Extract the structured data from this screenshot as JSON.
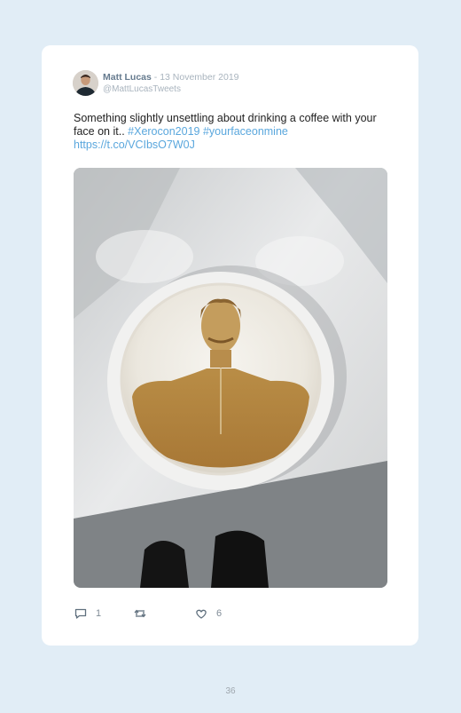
{
  "tweet": {
    "author_name": "Matt Lucas",
    "separator": " - ",
    "date": "13 November 2019",
    "handle": "@MattLucasTweets",
    "text_before": "Something slightly unsettling about drinking a coffee with your face on it.. ",
    "hashtag_1": "#Xerocon2019",
    "hashtag_2": "#yourfaceonmine",
    "link": "https://t.co/VCIbsO7W0J",
    "image_alt": "Latte with a face printed in the foam"
  },
  "actions": {
    "reply_count": "1",
    "like_count": "6",
    "reply_icon": "comment-bubble-icon",
    "retweet_icon": "retweet-icon",
    "like_icon": "heart-icon"
  },
  "page": {
    "number": "36"
  },
  "colors": {
    "background": "#e1edf6",
    "card": "#ffffff",
    "link": "#5aa7dd",
    "name": "#657a8e",
    "muted": "#a9b4be"
  }
}
